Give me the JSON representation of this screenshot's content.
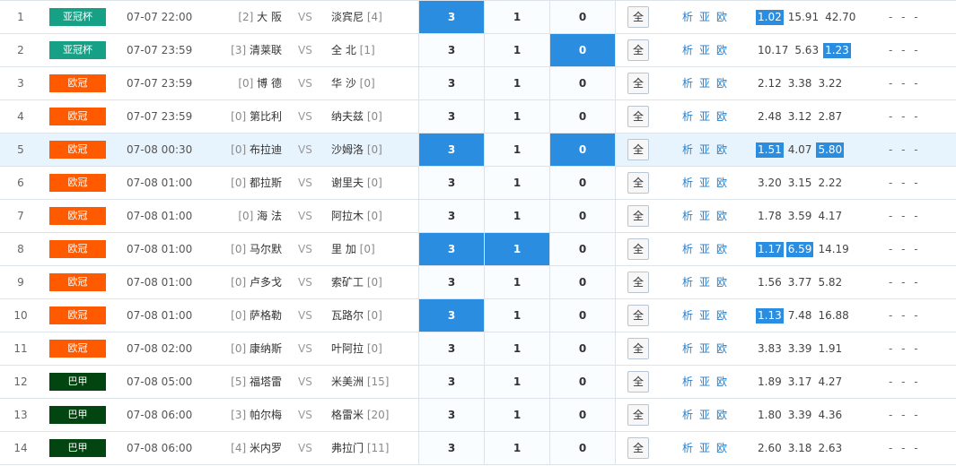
{
  "colors": {
    "亚冠杯": "#16a086",
    "欧冠": "#ff5a00",
    "巴甲": "#034510",
    "selected": "#2a8de0"
  },
  "all_label": "全",
  "links": [
    "析",
    "亚",
    "欧"
  ],
  "vs": "VS",
  "rows": [
    {
      "idx": "1",
      "league": "亚冠杯",
      "time": "07-07 22:00",
      "home_rank": "[2]",
      "home": "大 阪",
      "away": "淡宾尼",
      "away_rank": "[4]",
      "sel": [
        "3",
        "1",
        "0"
      ],
      "sel_on": [
        true,
        false,
        false
      ],
      "odds": [
        "1.02",
        "15.91",
        "42.70"
      ],
      "odds_on": [
        true,
        false,
        false
      ],
      "dash": "- - -",
      "hl": false
    },
    {
      "idx": "2",
      "league": "亚冠杯",
      "time": "07-07 23:59",
      "home_rank": "[3]",
      "home": "清莱联",
      "away": "全 北",
      "away_rank": "[1]",
      "sel": [
        "3",
        "1",
        "0"
      ],
      "sel_on": [
        false,
        false,
        true
      ],
      "odds": [
        "10.17",
        "5.63",
        "1.23"
      ],
      "odds_on": [
        false,
        false,
        true
      ],
      "dash": "- - -",
      "hl": false
    },
    {
      "idx": "3",
      "league": "欧冠",
      "time": "07-07 23:59",
      "home_rank": "[0]",
      "home": "博 德",
      "away": "华 沙",
      "away_rank": "[0]",
      "sel": [
        "3",
        "1",
        "0"
      ],
      "sel_on": [
        false,
        false,
        false
      ],
      "odds": [
        "2.12",
        "3.38",
        "3.22"
      ],
      "odds_on": [
        false,
        false,
        false
      ],
      "dash": "- - -",
      "hl": false
    },
    {
      "idx": "4",
      "league": "欧冠",
      "time": "07-07 23:59",
      "home_rank": "[0]",
      "home": "第比利",
      "away": "纳夫兹",
      "away_rank": "[0]",
      "sel": [
        "3",
        "1",
        "0"
      ],
      "sel_on": [
        false,
        false,
        false
      ],
      "odds": [
        "2.48",
        "3.12",
        "2.87"
      ],
      "odds_on": [
        false,
        false,
        false
      ],
      "dash": "- - -",
      "hl": false
    },
    {
      "idx": "5",
      "league": "欧冠",
      "time": "07-08 00:30",
      "home_rank": "[0]",
      "home": "布拉迪",
      "away": "沙姆洛",
      "away_rank": "[0]",
      "sel": [
        "3",
        "1",
        "0"
      ],
      "sel_on": [
        true,
        false,
        true
      ],
      "odds": [
        "1.51",
        "4.07",
        "5.80"
      ],
      "odds_on": [
        true,
        false,
        true
      ],
      "dash": "- - -",
      "hl": true
    },
    {
      "idx": "6",
      "league": "欧冠",
      "time": "07-08 01:00",
      "home_rank": "[0]",
      "home": "都拉斯",
      "away": "谢里夫",
      "away_rank": "[0]",
      "sel": [
        "3",
        "1",
        "0"
      ],
      "sel_on": [
        false,
        false,
        false
      ],
      "odds": [
        "3.20",
        "3.15",
        "2.22"
      ],
      "odds_on": [
        false,
        false,
        false
      ],
      "dash": "- - -",
      "hl": false
    },
    {
      "idx": "7",
      "league": "欧冠",
      "time": "07-08 01:00",
      "home_rank": "[0]",
      "home": "海 法",
      "away": "阿拉木",
      "away_rank": "[0]",
      "sel": [
        "3",
        "1",
        "0"
      ],
      "sel_on": [
        false,
        false,
        false
      ],
      "odds": [
        "1.78",
        "3.59",
        "4.17"
      ],
      "odds_on": [
        false,
        false,
        false
      ],
      "dash": "- - -",
      "hl": false
    },
    {
      "idx": "8",
      "league": "欧冠",
      "time": "07-08 01:00",
      "home_rank": "[0]",
      "home": "马尔默",
      "away": "里 加",
      "away_rank": "[0]",
      "sel": [
        "3",
        "1",
        "0"
      ],
      "sel_on": [
        true,
        true,
        false
      ],
      "odds": [
        "1.17",
        "6.59",
        "14.19"
      ],
      "odds_on": [
        true,
        true,
        false
      ],
      "dash": "- - -",
      "hl": false
    },
    {
      "idx": "9",
      "league": "欧冠",
      "time": "07-08 01:00",
      "home_rank": "[0]",
      "home": "卢多戈",
      "away": "索矿工",
      "away_rank": "[0]",
      "sel": [
        "3",
        "1",
        "0"
      ],
      "sel_on": [
        false,
        false,
        false
      ],
      "odds": [
        "1.56",
        "3.77",
        "5.82"
      ],
      "odds_on": [
        false,
        false,
        false
      ],
      "dash": "- - -",
      "hl": false
    },
    {
      "idx": "10",
      "league": "欧冠",
      "time": "07-08 01:00",
      "home_rank": "[0]",
      "home": "萨格勒",
      "away": "瓦路尔",
      "away_rank": "[0]",
      "sel": [
        "3",
        "1",
        "0"
      ],
      "sel_on": [
        true,
        false,
        false
      ],
      "odds": [
        "1.13",
        "7.48",
        "16.88"
      ],
      "odds_on": [
        true,
        false,
        false
      ],
      "dash": "- - -",
      "hl": false
    },
    {
      "idx": "11",
      "league": "欧冠",
      "time": "07-08 02:00",
      "home_rank": "[0]",
      "home": "康纳斯",
      "away": "叶阿拉",
      "away_rank": "[0]",
      "sel": [
        "3",
        "1",
        "0"
      ],
      "sel_on": [
        false,
        false,
        false
      ],
      "odds": [
        "3.83",
        "3.39",
        "1.91"
      ],
      "odds_on": [
        false,
        false,
        false
      ],
      "dash": "- - -",
      "hl": false
    },
    {
      "idx": "12",
      "league": "巴甲",
      "time": "07-08 05:00",
      "home_rank": "[5]",
      "home": "福塔雷",
      "away": "米美洲",
      "away_rank": "[15]",
      "sel": [
        "3",
        "1",
        "0"
      ],
      "sel_on": [
        false,
        false,
        false
      ],
      "odds": [
        "1.89",
        "3.17",
        "4.27"
      ],
      "odds_on": [
        false,
        false,
        false
      ],
      "dash": "- - -",
      "hl": false
    },
    {
      "idx": "13",
      "league": "巴甲",
      "time": "07-08 06:00",
      "home_rank": "[3]",
      "home": "帕尔梅",
      "away": "格雷米",
      "away_rank": "[20]",
      "sel": [
        "3",
        "1",
        "0"
      ],
      "sel_on": [
        false,
        false,
        false
      ],
      "odds": [
        "1.80",
        "3.39",
        "4.36"
      ],
      "odds_on": [
        false,
        false,
        false
      ],
      "dash": "- - -",
      "hl": false
    },
    {
      "idx": "14",
      "league": "巴甲",
      "time": "07-08 06:00",
      "home_rank": "[4]",
      "home": "米内罗",
      "away": "弗拉门",
      "away_rank": "[11]",
      "sel": [
        "3",
        "1",
        "0"
      ],
      "sel_on": [
        false,
        false,
        false
      ],
      "odds": [
        "2.60",
        "3.18",
        "2.63"
      ],
      "odds_on": [
        false,
        false,
        false
      ],
      "dash": "- - -",
      "hl": false
    }
  ]
}
